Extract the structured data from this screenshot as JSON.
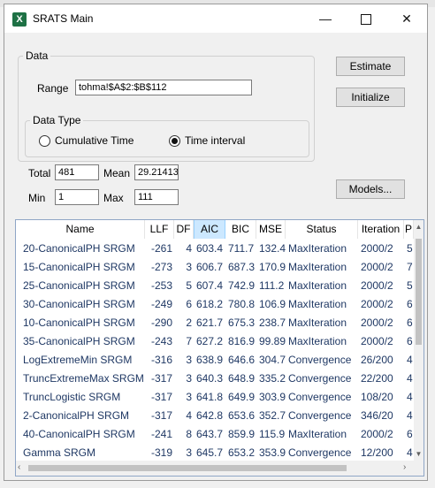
{
  "window": {
    "title": "SRATS Main",
    "app_icon_letter": "X",
    "minimize_glyph": "—",
    "close_glyph": "✕"
  },
  "data_group": {
    "label": "Data",
    "range_label": "Range",
    "range_value": "tohma!$A$2:$B$112"
  },
  "data_type": {
    "label": "Data Type",
    "option_cumulative": "Cumulative Time",
    "option_interval": "Time interval",
    "selected": "Time interval"
  },
  "stats": {
    "total_label": "Total",
    "total_value": "481",
    "mean_label": "Mean",
    "mean_value": "29.21413",
    "min_label": "Min",
    "min_value": "1",
    "max_label": "Max",
    "max_value": "111"
  },
  "buttons": {
    "estimate": "Estimate",
    "initialize": "Initialize",
    "models": "Models..."
  },
  "table": {
    "columns": [
      "Name",
      "LLF",
      "DF",
      "AIC",
      "BIC",
      "MSE",
      "Status",
      "Iteration",
      "P"
    ],
    "sorted_column": "AIC",
    "rows": [
      [
        "20-CanonicalPH SRGM",
        "-261",
        "4",
        "603.4",
        "711.7",
        "132.4",
        "MaxIteration",
        "2000/2",
        "5"
      ],
      [
        "15-CanonicalPH SRGM",
        "-273",
        "3",
        "606.7",
        "687.3",
        "170.9",
        "MaxIteration",
        "2000/2",
        "7"
      ],
      [
        "25-CanonicalPH SRGM",
        "-253",
        "5",
        "607.4",
        "742.9",
        "111.2",
        "MaxIteration",
        "2000/2",
        "5"
      ],
      [
        "30-CanonicalPH SRGM",
        "-249",
        "6",
        "618.2",
        "780.8",
        "106.9",
        "MaxIteration",
        "2000/2",
        "6"
      ],
      [
        "10-CanonicalPH SRGM",
        "-290",
        "2",
        "621.7",
        "675.3",
        "238.7",
        "MaxIteration",
        "2000/2",
        "6"
      ],
      [
        "35-CanonicalPH SRGM",
        "-243",
        "7",
        "627.2",
        "816.9",
        "99.89",
        "MaxIteration",
        "2000/2",
        "6"
      ],
      [
        "LogExtremeMin SRGM",
        "-316",
        "3",
        "638.9",
        "646.6",
        "304.7",
        "Convergence",
        "26/200",
        "4"
      ],
      [
        "TruncExtremeMax SRGM",
        "-317",
        "3",
        "640.3",
        "648.9",
        "335.2",
        "Convergence",
        "22/200",
        "4"
      ],
      [
        "TruncLogistic SRGM",
        "-317",
        "3",
        "641.8",
        "649.9",
        "303.9",
        "Convergence",
        "108/20",
        "4"
      ],
      [
        "2-CanonicalPH SRGM",
        "-317",
        "4",
        "642.8",
        "653.6",
        "352.7",
        "Convergence",
        "346/20",
        "4"
      ],
      [
        "40-CanonicalPH SRGM",
        "-241",
        "8",
        "643.7",
        "859.9",
        "115.9",
        "MaxIteration",
        "2000/2",
        "6"
      ],
      [
        "Gamma SRGM",
        "-319",
        "3",
        "645.7",
        "653.2",
        "353.9",
        "Convergence",
        "12/200",
        "4"
      ]
    ]
  },
  "scroll_glyphs": {
    "up": "▲",
    "down": "▼",
    "left": "‹",
    "right": "›"
  }
}
